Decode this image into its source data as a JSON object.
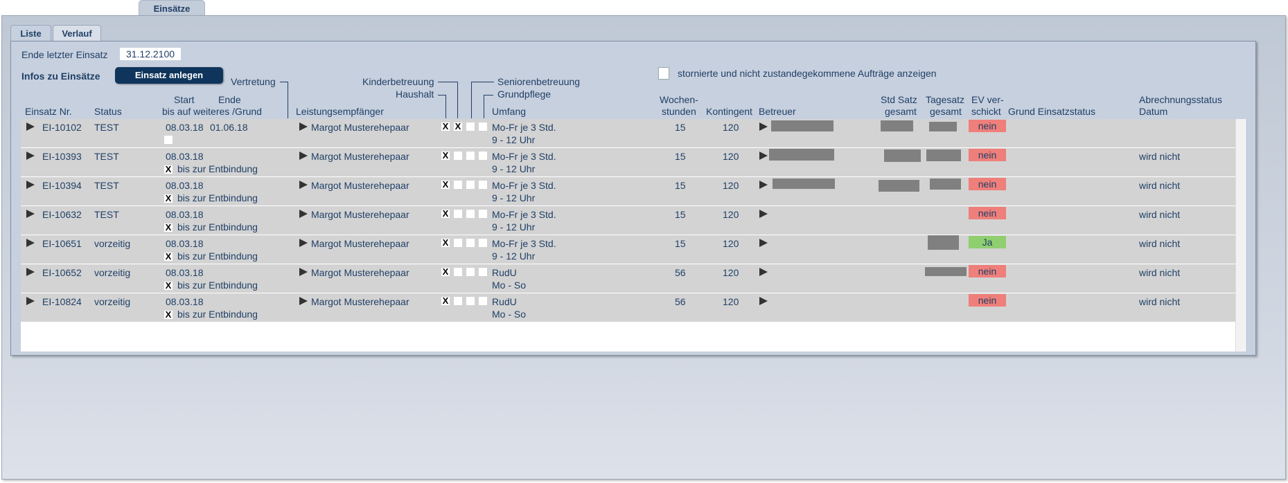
{
  "top_tab": "Einsätze",
  "sub_tabs": [
    "Liste",
    "Verlauf"
  ],
  "ende_label": "Ende letzter Einsatz",
  "ende_value": "31.12.2100",
  "infos_label": "Infos zu Einsätze",
  "anlegen_button": "Einsatz anlegen",
  "storno_label": "stornierte und nicht zustandegekommene Aufträge anzeigen",
  "headers": {
    "vertretung": "Vertretung",
    "kinderbetreuung": "Kinderbetreuung",
    "seniorenbetreuung": "Seniorenbetreuung",
    "haushalt": "Haushalt",
    "grundpflege": "Grundpflege",
    "start": "Start",
    "ende": "Ende",
    "bis_auf": "bis auf weiteres /Grund",
    "einsatz_nr": "Einsatz Nr.",
    "status": "Status",
    "leistungsempfaenger": "Leistungsempfänger",
    "umfang": "Umfang",
    "wochen1": "Wochen-",
    "wochen2": "stunden",
    "kontingent": "Kontingent",
    "betreuer": "Betreuer",
    "std_satz1": "Std Satz",
    "std_satz2": "gesamt",
    "tagessatz1": "Tagesatz",
    "tagessatz2": "gesamt",
    "ev1": "EV ver-",
    "ev2": "schickt",
    "grund": "Grund Einsatzstatus",
    "abr1": "Abrechnungsstatus",
    "abr2": "Datum"
  },
  "rows": [
    {
      "nr": "EI-10102",
      "status": "TEST",
      "start": "08.03.18",
      "ende": "01.06.18",
      "grund": "",
      "grund_checked": "",
      "empfaenger": "Margot Musterehepaar",
      "kinder": "X",
      "vertretung": "X",
      "umfang1": "Mo-Fr je 3 Std.",
      "umfang2": "9 - 12 Uhr",
      "wochen": "15",
      "kontingent": "120",
      "ev": "nein",
      "abr": ""
    },
    {
      "nr": "EI-10393",
      "status": "TEST",
      "start": "08.03.18",
      "ende": "",
      "grund": "bis zur Entbindung",
      "grund_checked": "X",
      "empfaenger": "Margot Musterehepaar",
      "kinder": "X",
      "vertretung": "",
      "umfang1": "Mo-Fr je 3 Std.",
      "umfang2": "9 - 12 Uhr",
      "wochen": "15",
      "kontingent": "120",
      "ev": "nein",
      "abr": "wird nicht"
    },
    {
      "nr": "EI-10394",
      "status": "TEST",
      "start": "08.03.18",
      "ende": "",
      "grund": "bis zur Entbindung",
      "grund_checked": "X",
      "empfaenger": "Margot Musterehepaar",
      "kinder": "X",
      "vertretung": "",
      "umfang1": "Mo-Fr je 3 Std.",
      "umfang2": "9 - 12 Uhr",
      "wochen": "15",
      "kontingent": "120",
      "ev": "nein",
      "abr": "wird nicht"
    },
    {
      "nr": "EI-10632",
      "status": "TEST",
      "start": "08.03.18",
      "ende": "",
      "grund": "bis zur Entbindung",
      "grund_checked": "X",
      "empfaenger": "Margot Musterehepaar",
      "kinder": "X",
      "vertretung": "",
      "umfang1": "Mo-Fr je 3 Std.",
      "umfang2": "9 - 12 Uhr",
      "wochen": "15",
      "kontingent": "120",
      "ev": "nein",
      "abr": "wird nicht"
    },
    {
      "nr": "EI-10651",
      "status": "vorzeitig",
      "start": "08.03.18",
      "ende": "",
      "grund": "bis zur Entbindung",
      "grund_checked": "X",
      "empfaenger": "Margot Musterehepaar",
      "kinder": "X",
      "vertretung": "",
      "umfang1": "Mo-Fr je 3 Std.",
      "umfang2": "9 - 12 Uhr",
      "wochen": "15",
      "kontingent": "120",
      "ev": "Ja",
      "abr": "wird nicht"
    },
    {
      "nr": "EI-10652",
      "status": "vorzeitig",
      "start": "08.03.18",
      "ende": "",
      "grund": "bis zur Entbindung",
      "grund_checked": "X",
      "empfaenger": "Margot Musterehepaar",
      "kinder": "X",
      "vertretung": "",
      "umfang1": "RudU",
      "umfang2": "Mo - So",
      "wochen": "56",
      "kontingent": "120",
      "ev": "nein",
      "abr": "wird nicht"
    },
    {
      "nr": "EI-10824",
      "status": "vorzeitig",
      "start": "08.03.18",
      "ende": "",
      "grund": "bis zur Entbindung",
      "grund_checked": "X",
      "empfaenger": "Margot Musterehepaar",
      "kinder": "X",
      "vertretung": "",
      "umfang1": "RudU",
      "umfang2": "Mo - So",
      "wochen": "56",
      "kontingent": "120",
      "ev": "nein",
      "abr": "wird nicht"
    }
  ],
  "colors": {
    "ev_no": "#ef7f7a",
    "ev_yes": "#8fcf6f",
    "button": "#0f355c",
    "text": "#1f3f66"
  }
}
